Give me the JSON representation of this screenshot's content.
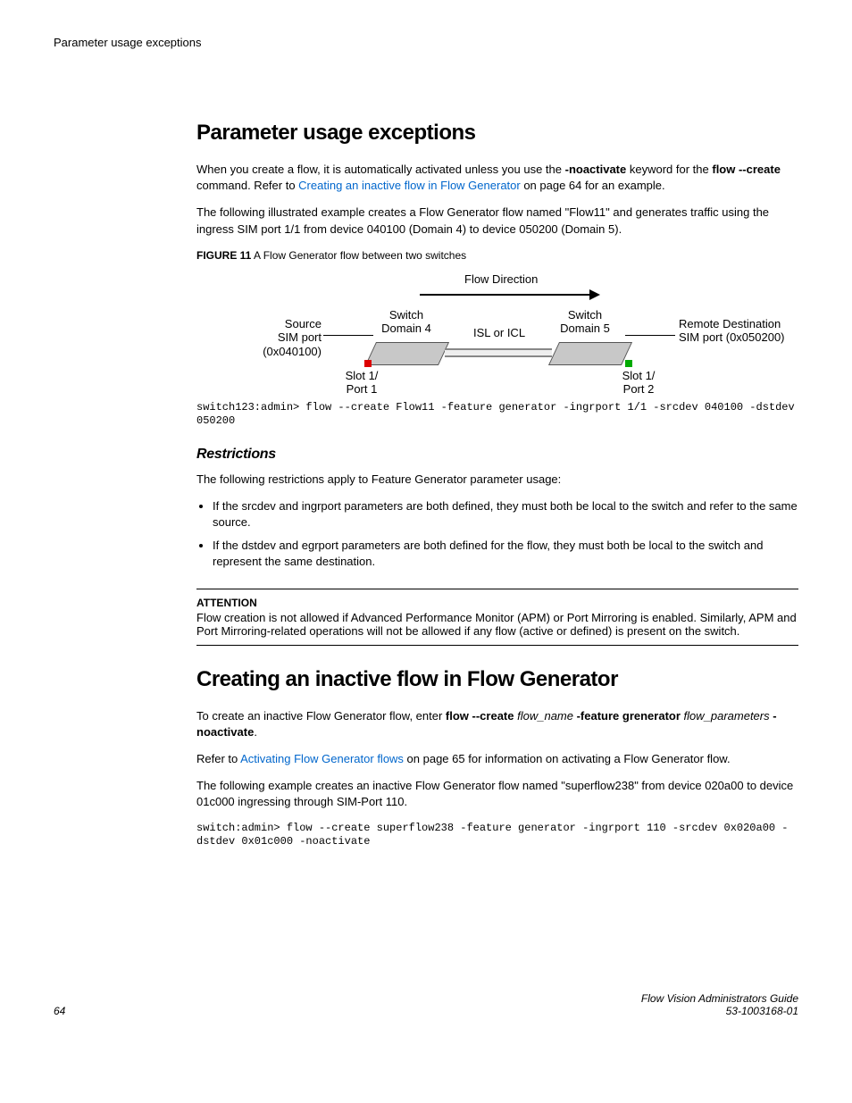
{
  "header": {
    "running_title": "Parameter usage exceptions"
  },
  "section1": {
    "heading": "Parameter usage exceptions",
    "p1a": "When you create a flow, it is automatically activated unless you use the ",
    "p1b": "-noactivate",
    "p1c": " keyword for the ",
    "p1d": "flow --create",
    "p1e": " command. Refer to ",
    "p1link": "Creating an inactive flow in Flow Generator",
    "p1f": " on page 64 for an example.",
    "p2": "The following illustrated example creates a Flow Generator flow named \"Flow11\" and generates traffic using the ingress SIM port 1/1 from device 040100 (Domain 4) to device 050200 (Domain 5).",
    "fig_label": "FIGURE 11",
    "fig_caption": " A Flow Generator flow between two switches",
    "diagram": {
      "flow_direction": "Flow Direction",
      "source": "Source",
      "source_port": "SIM port (0x040100)",
      "switch4a": "Switch",
      "switch4b": "Domain 4",
      "isl": "ISL or ICL",
      "switch5a": "Switch",
      "switch5b": "Domain 5",
      "remote": "Remote Destination",
      "remote_port": "SIM port (0x050200)",
      "slot1a": "Slot 1/",
      "slot1b": "Port 1",
      "slot2a": "Slot 1/",
      "slot2b": "Port 2"
    },
    "code1": "switch123:admin> flow --create Flow11 -feature generator -ingrport 1/1 -srcdev 040100 -dstdev 050200"
  },
  "restrictions": {
    "heading": "Restrictions",
    "intro": "The following restrictions apply to Feature Generator parameter usage:",
    "b1": "If the srcdev and ingrport parameters are both defined, they must both be local to the switch and refer to the same source.",
    "b2": "If the dstdev and egrport parameters are both defined for the flow, they must both be local to the switch and represent the same destination."
  },
  "attention": {
    "label": "ATTENTION",
    "text": "Flow creation is not allowed if Advanced Performance Monitor (APM) or Port Mirroring is enabled. Similarly, APM and Port Mirroring-related operations will not be allowed if any flow (active or defined) is present on the switch."
  },
  "section2": {
    "heading": "Creating an inactive flow in Flow Generator",
    "p1a": "To create an inactive Flow Generator flow, enter ",
    "p1b": "flow --create",
    "p1c": " flow_name ",
    "p1d": "-feature grenerator",
    "p1e": " flow_parameters ",
    "p1f": "-noactivate",
    "p1g": ".",
    "p2a": "Refer to ",
    "p2link": "Activating Flow Generator flows",
    "p2b": " on page 65 for information on activating a Flow Generator flow.",
    "p3": "The following example creates an inactive Flow Generator flow named \"superflow238\" from device 020a00 to device 01c000 ingressing through SIM-Port 110.",
    "code": "switch:admin> flow --create superflow238 -feature generator -ingrport 110 -srcdev 0x020a00 -dstdev 0x01c000 -noactivate"
  },
  "footer": {
    "page_num": "64",
    "guide": "Flow Vision Administrators Guide",
    "docnum": "53-1003168-01"
  }
}
